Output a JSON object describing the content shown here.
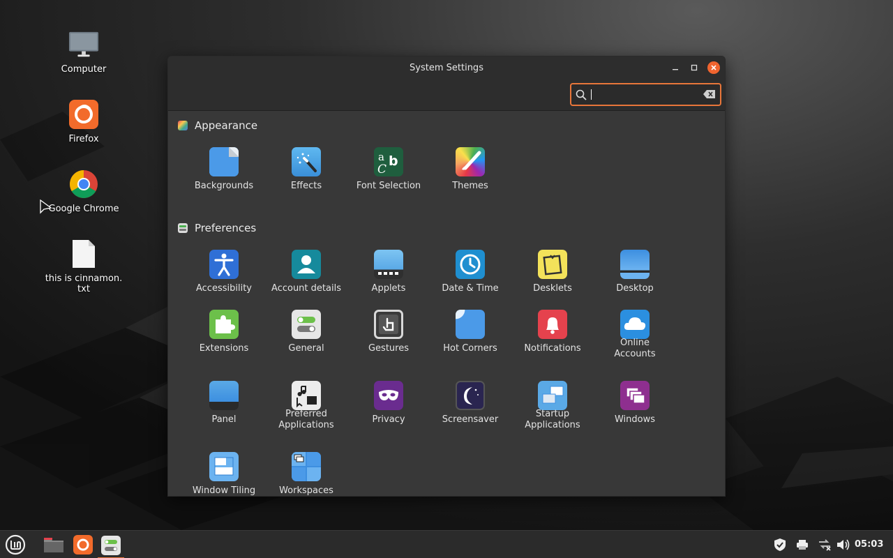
{
  "desktop": {
    "icons": [
      {
        "label": "Computer"
      },
      {
        "label": "Firefox"
      },
      {
        "label": "Google Chrome"
      },
      {
        "label": "this is cinnamon.\ntxt"
      }
    ]
  },
  "window": {
    "title": "System Settings",
    "search": {
      "value": "",
      "placeholder": ""
    }
  },
  "sections": {
    "appearance": {
      "title": "Appearance",
      "items": [
        "Backgrounds",
        "Effects",
        "Font Selection",
        "Themes"
      ]
    },
    "preferences": {
      "title": "Preferences",
      "items": [
        "Accessibility",
        "Account details",
        "Applets",
        "Date & Time",
        "Desklets",
        "Desktop",
        "Extensions",
        "General",
        "Gestures",
        "Hot Corners",
        "Notifications",
        "Online Accounts",
        "Panel",
        "Preferred Applications",
        "Privacy",
        "Screensaver",
        "Startup Applications",
        "Windows",
        "Window Tiling",
        "Workspaces"
      ]
    }
  },
  "taskbar": {
    "clock": "05:03"
  },
  "colors": {
    "accent": "#e8763a",
    "close": "#f0642f",
    "window_bg": "#383838",
    "titlebar_bg": "#2d2d2d"
  }
}
